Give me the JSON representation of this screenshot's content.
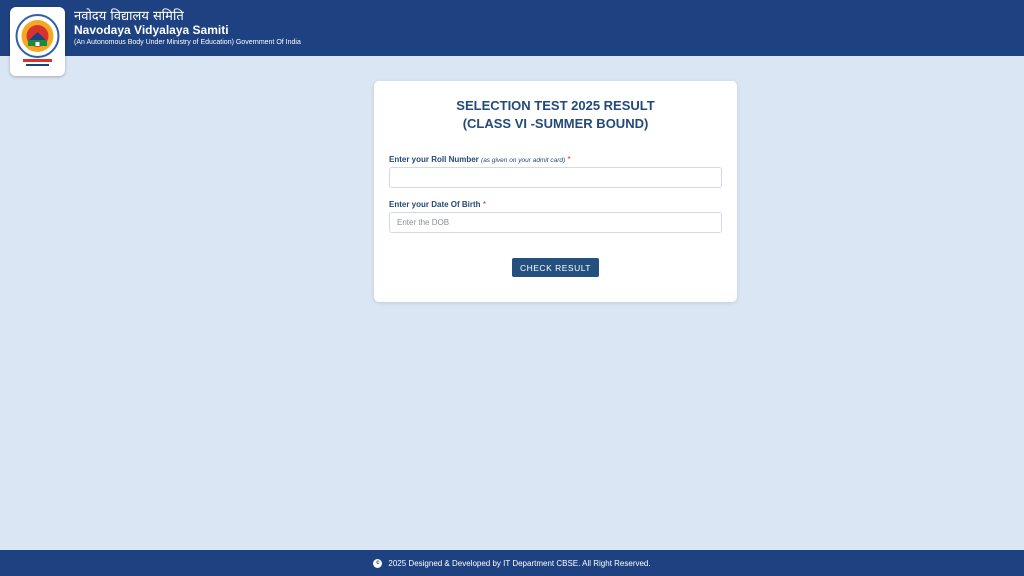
{
  "header": {
    "title_hindi": "नवोदय विद्यालय समिति",
    "title": "Navodaya Vidyalaya Samiti",
    "subtitle": "(An Autonomous Body Under Ministry of Education) Government Of India"
  },
  "form": {
    "title_line1": "SELECTION TEST 2025 RESULT",
    "title_line2": "(CLASS VI -SUMMER BOUND)",
    "roll": {
      "label": "Enter your Roll Number",
      "hint": "(as given on your admit card)",
      "required_mark": "*",
      "value": "",
      "placeholder": ""
    },
    "dob": {
      "label": "Enter your Date Of Birth",
      "required_mark": "*",
      "value": "",
      "placeholder": "Enter the DOB"
    },
    "submit_label": "CHECK RESULT"
  },
  "footer": {
    "copyright_symbol": "c",
    "text": "2025 Designed & Developed by IT Department CBSE. All Right Reserved."
  },
  "colors": {
    "header_bg": "#1e4181",
    "page_bg": "#dbe6f4",
    "accent": "#23507e",
    "required": "#d32f2f"
  }
}
